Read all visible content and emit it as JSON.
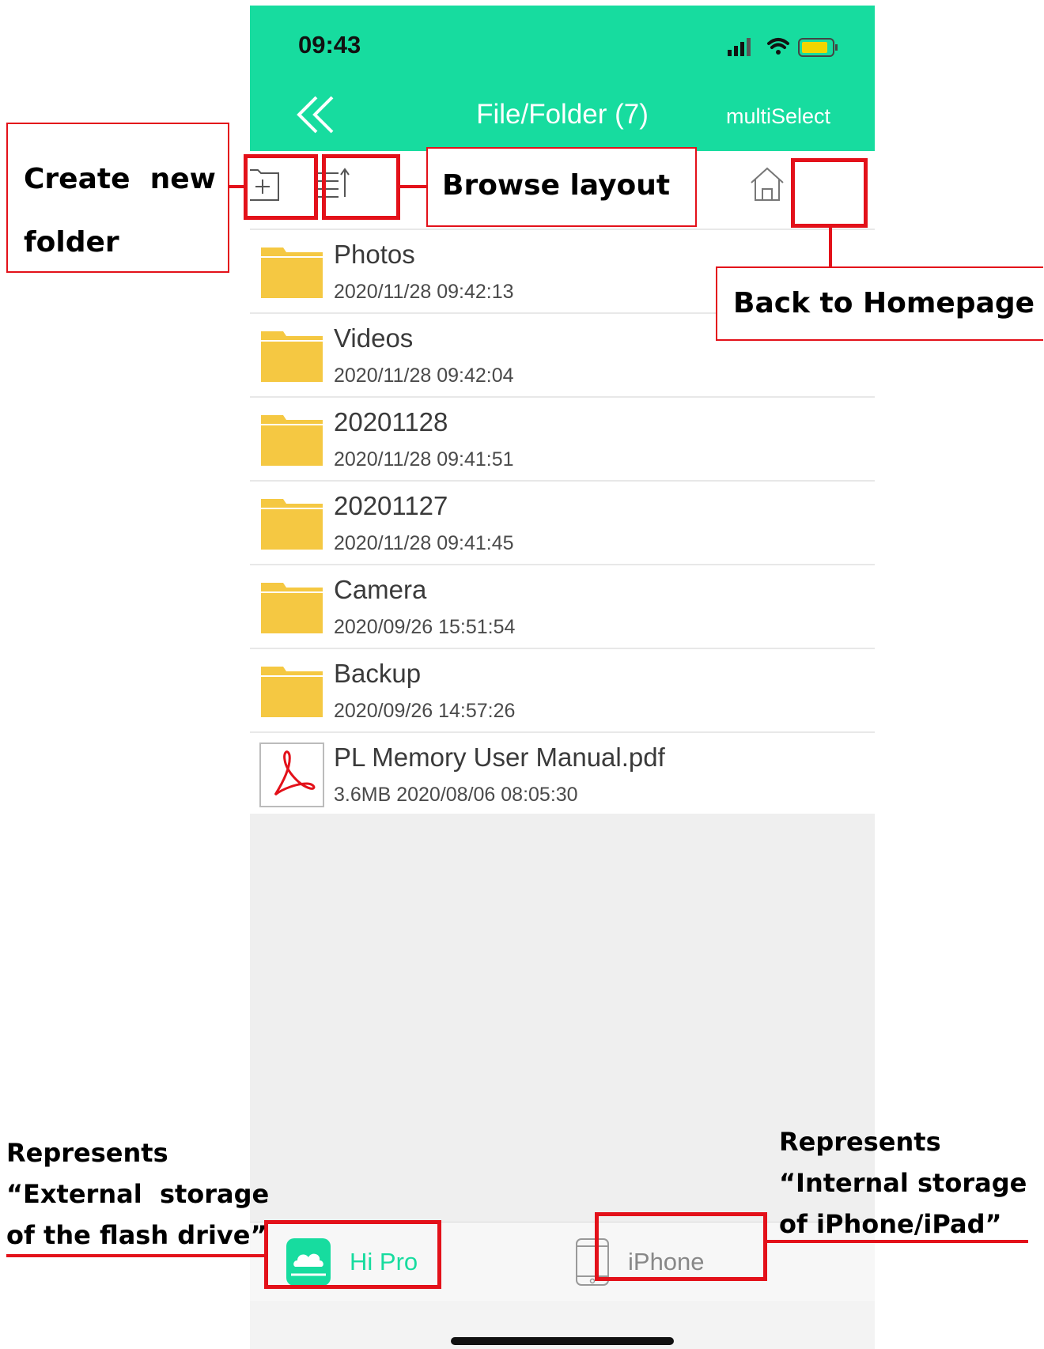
{
  "status_bar": {
    "time": "09:43"
  },
  "nav": {
    "title": "File/Folder (7)",
    "multiselect": "multiSelect"
  },
  "files": [
    {
      "name": "Photos",
      "meta": "2020/11/28 09:42:13",
      "type": "folder"
    },
    {
      "name": "Videos",
      "meta": "2020/11/28 09:42:04",
      "type": "folder"
    },
    {
      "name": "20201128",
      "meta": "2020/11/28 09:41:51",
      "type": "folder"
    },
    {
      "name": "20201127",
      "meta": "2020/11/28 09:41:45",
      "type": "folder"
    },
    {
      "name": "Camera",
      "meta": "2020/09/26 15:51:54",
      "type": "folder"
    },
    {
      "name": "Backup",
      "meta": "2020/09/26 14:57:26",
      "type": "folder"
    },
    {
      "name": "PL Memory User Manual.pdf",
      "meta": "3.6MB 2020/08/06 08:05:30",
      "type": "pdf"
    }
  ],
  "tabs": {
    "hipro": "Hi Pro",
    "iphone": "iPhone"
  },
  "annotations": {
    "create_folder_line1": "Create  new",
    "create_folder_line2": "folder",
    "browse_layout": "Browse layout",
    "back_home": "Back to Homepage",
    "external_line1": "Represents",
    "external_line2": "“External  storage",
    "external_line3": "of the flash drive”",
    "internal_line1": "Represents",
    "internal_line2": "“Internal storage",
    "internal_line3": "of iPhone/iPad”"
  },
  "colors": {
    "accent": "#17dc9f",
    "folder": "#f5c842",
    "callout": "#e3111a"
  }
}
